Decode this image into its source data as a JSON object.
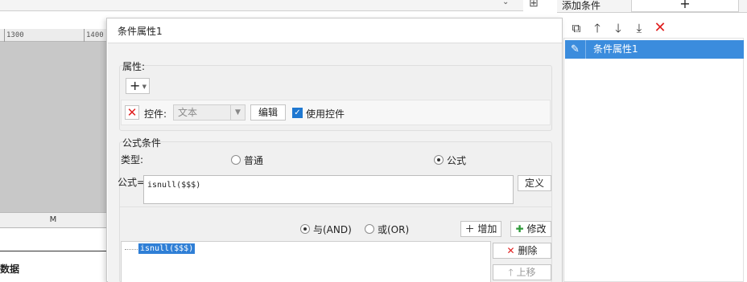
{
  "background": {
    "ruler_ticks": [
      "1300",
      "1400"
    ],
    "column_header": "M",
    "data_label": "数据"
  },
  "right_panel": {
    "tab_label": "添加条件",
    "add_button": "+",
    "toolbar_icons": [
      "copy-icon",
      "arrow-up-icon",
      "arrow-down-icon",
      "move-bottom-icon",
      "delete-icon"
    ],
    "list_items": [
      {
        "label": "条件属性1",
        "selected": true
      }
    ]
  },
  "dialog": {
    "title": "条件属性1",
    "properties": {
      "title": "属性:",
      "add_dropdown": "+",
      "control_label": "控件:",
      "control_value": "文本",
      "edit_button": "编辑",
      "use_control_label": "使用控件",
      "use_control_checked": true
    },
    "formula_condition": {
      "title": "公式条件",
      "type_label": "类型:",
      "type_options": [
        {
          "label": "普通",
          "selected": false
        },
        {
          "label": "公式",
          "selected": true
        }
      ],
      "formula_label": "公式=",
      "formula_value": "isnull($$$)",
      "define_button": "定义",
      "logic_options": [
        {
          "label": "与(AND)",
          "selected": true
        },
        {
          "label": "或(OR)",
          "selected": false
        }
      ],
      "add_button": "增加",
      "modify_button": "修改",
      "conditions": [
        "isnull($$$)"
      ],
      "delete_button": "删除",
      "move_up_button": "上移"
    }
  }
}
